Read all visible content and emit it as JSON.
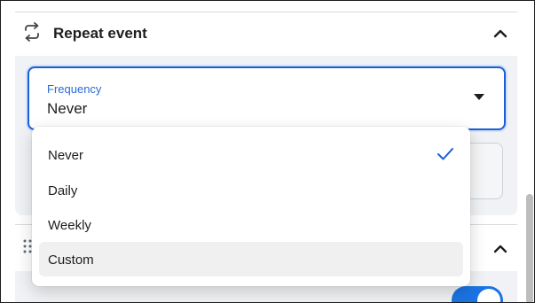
{
  "section": {
    "title": "Repeat event",
    "icon": "repeat-icon",
    "chevron": "chevron-up-icon"
  },
  "frequency": {
    "label": "Frequency",
    "value": "Never",
    "icon": "caret-down-icon"
  },
  "menu": {
    "items": [
      {
        "label": "Never",
        "selected": true
      },
      {
        "label": "Daily",
        "selected": false
      },
      {
        "label": "Weekly",
        "selected": false
      },
      {
        "label": "Custom",
        "selected": false,
        "hovered": true
      }
    ],
    "check_icon": "checkmark-icon"
  },
  "colors": {
    "accent": "#1b5fd6",
    "toggle_on": "#1b74e4",
    "panel_bg": "#f0f2f5"
  },
  "toggle": {
    "on": true
  }
}
